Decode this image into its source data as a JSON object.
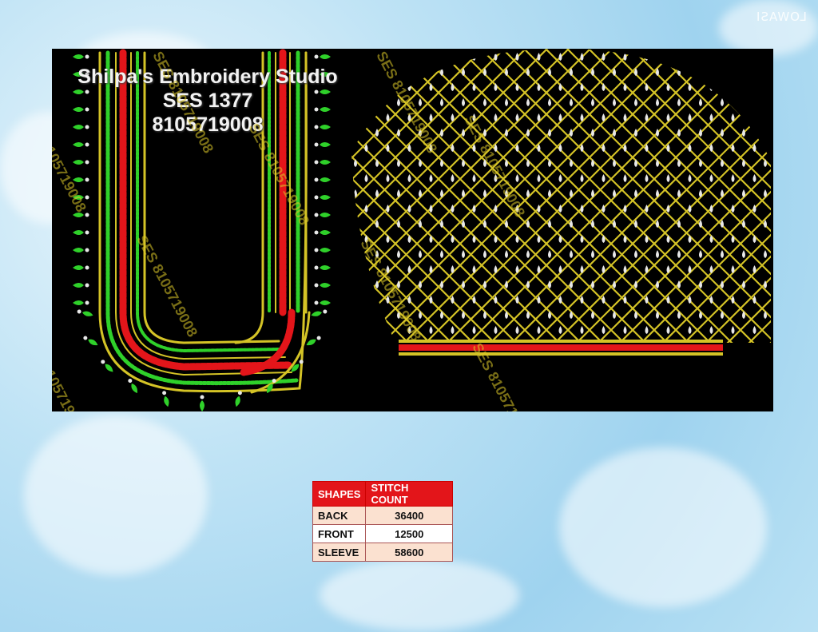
{
  "corner_mark": "LOWASI",
  "studio": {
    "name": "Shilpa's Embroidery Studio",
    "code": "SES 1377",
    "phone": "8105719008"
  },
  "watermarks": [
    "SES 8105719008",
    "8105719008",
    "SES 8105719008",
    "SES 8105719008",
    "SES 8105719008",
    "SES 8105719008",
    "SES 8105719008",
    "8105719008",
    "SES 8105719008"
  ],
  "stitch_table": {
    "headers": [
      "SHAPES",
      "STITCH COUNT"
    ],
    "rows": [
      {
        "shape": "BACK",
        "count": "36400"
      },
      {
        "shape": "FRONT",
        "count": "12500"
      },
      {
        "shape": "SLEEVE",
        "count": "58600"
      }
    ]
  },
  "colors": {
    "panel": "#000000",
    "gold": "#d4c326",
    "red": "#e3151a",
    "green": "#2fd12a",
    "pearl": "#e8e8e8"
  }
}
